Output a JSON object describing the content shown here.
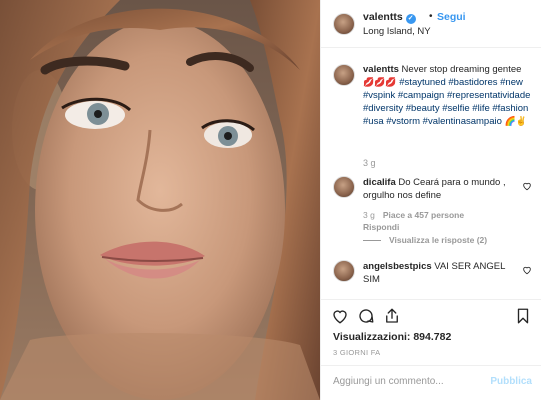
{
  "post": {
    "username": "valentts",
    "verified_mark": "✓",
    "separator": "•",
    "follow_label": "Segui",
    "location": "Long Island, NY"
  },
  "caption": {
    "username": "valentts",
    "text": " Never stop dreaming gentee ",
    "emoji": "💋💋💋",
    "hashtags": "#staytuned #bastidores #new #vspink #campaign #representatividade #diversity #beauty #selfie #life #fashion #usa #vstorm #valentinasampaio",
    "tail_emoji": "🌈✌",
    "time": "3 g"
  },
  "comments": [
    {
      "username": "dicalifa",
      "text": " Do Ceará para o mundo , orgulho nos define",
      "time": "3 g",
      "likes": "Piace a 457 persone",
      "reply_label": "Rispondi",
      "view_replies": "Visualizza le risposte (2)"
    },
    {
      "username": "angelsbestpics",
      "text": " VAI SER ANGEL SIM"
    }
  ],
  "actions": {
    "like_icon": "heart-icon",
    "comment_icon": "comment-icon",
    "share_icon": "share-icon",
    "save_icon": "bookmark-icon"
  },
  "stats": {
    "views": "Visualizzazioni: 894.782",
    "ago": "3 GIORNI FA"
  },
  "composer": {
    "placeholder": "Aggiungi un commento...",
    "publish_label": "Pubblica"
  },
  "colors": {
    "link_blue": "#3897f0",
    "hashtag_blue": "#003569",
    "muted": "#999999",
    "border": "#efefef"
  }
}
